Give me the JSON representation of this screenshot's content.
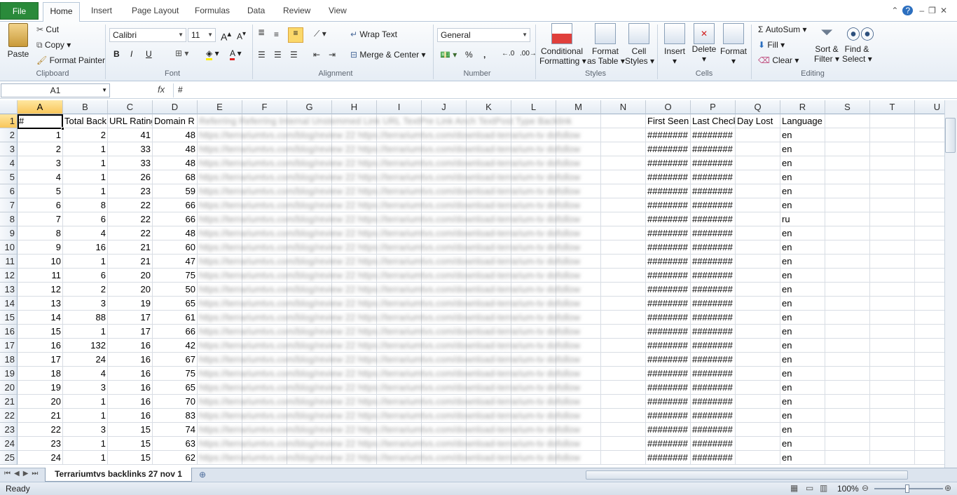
{
  "tabs": {
    "file": "File",
    "home": "Home",
    "insert": "Insert",
    "page_layout": "Page Layout",
    "formulas": "Formulas",
    "data": "Data",
    "review": "Review",
    "view": "View"
  },
  "clipboard": {
    "paste": "Paste",
    "cut": "Cut",
    "copy": "Copy",
    "format_painter": "Format Painter",
    "label": "Clipboard"
  },
  "font": {
    "name": "Calibri",
    "size": "11",
    "bold": "B",
    "italic": "I",
    "underline": "U",
    "label": "Font"
  },
  "alignment": {
    "wrap_text": "Wrap Text",
    "merge_center": "Merge & Center",
    "label": "Alignment"
  },
  "number": {
    "format": "General",
    "percent": "%",
    "comma": ",",
    "label": "Number"
  },
  "styles": {
    "conditional": "Conditional",
    "formatting": "Formatting",
    "format": "Format",
    "as_table": "as Table",
    "cell": "Cell",
    "styles_word": "Styles",
    "label": "Styles"
  },
  "cells": {
    "insert": "Insert",
    "delete": "Delete",
    "format": "Format",
    "label": "Cells"
  },
  "editing": {
    "autosum": "AutoSum",
    "fill": "Fill",
    "clear": "Clear",
    "sort": "Sort &",
    "filter": "Filter",
    "find": "Find &",
    "select": "Select",
    "label": "Editing"
  },
  "formula_bar": {
    "name_box": "A1",
    "fx": "fx",
    "content": "#"
  },
  "columns": [
    "A",
    "B",
    "C",
    "D",
    "E",
    "F",
    "G",
    "H",
    "I",
    "J",
    "K",
    "L",
    "M",
    "N",
    "O",
    "P",
    "Q",
    "R",
    "S",
    "T",
    "U"
  ],
  "headers": {
    "A": "#",
    "B": "Total Back",
    "C": "URL Rating",
    "D": "Domain R",
    "O": "First Seen",
    "P": "Last Check",
    "Q": "Day Lost",
    "R": "Language"
  },
  "blurred_header": "Referring Referring Internal Unstemmed Link URL TextPre Link Anch TextPost Type  Backlink",
  "rows": [
    {
      "n": "2",
      "a": "1",
      "b": "2",
      "c": "41",
      "d": "48",
      "o": "########",
      "p": "########",
      "r": "en"
    },
    {
      "n": "3",
      "a": "2",
      "b": "1",
      "c": "33",
      "d": "48",
      "o": "########",
      "p": "########",
      "r": "en"
    },
    {
      "n": "4",
      "a": "3",
      "b": "1",
      "c": "33",
      "d": "48",
      "o": "########",
      "p": "########",
      "r": "en"
    },
    {
      "n": "5",
      "a": "4",
      "b": "1",
      "c": "26",
      "d": "68",
      "o": "########",
      "p": "########",
      "r": "en"
    },
    {
      "n": "6",
      "a": "5",
      "b": "1",
      "c": "23",
      "d": "59",
      "o": "########",
      "p": "########",
      "r": "en"
    },
    {
      "n": "7",
      "a": "6",
      "b": "8",
      "c": "22",
      "d": "66",
      "o": "########",
      "p": "########",
      "r": "en"
    },
    {
      "n": "8",
      "a": "7",
      "b": "6",
      "c": "22",
      "d": "66",
      "o": "########",
      "p": "########",
      "r": "ru"
    },
    {
      "n": "9",
      "a": "8",
      "b": "4",
      "c": "22",
      "d": "48",
      "o": "########",
      "p": "########",
      "r": "en"
    },
    {
      "n": "10",
      "a": "9",
      "b": "16",
      "c": "21",
      "d": "60",
      "o": "########",
      "p": "########",
      "r": "en"
    },
    {
      "n": "11",
      "a": "10",
      "b": "1",
      "c": "21",
      "d": "47",
      "o": "########",
      "p": "########",
      "r": "en"
    },
    {
      "n": "12",
      "a": "11",
      "b": "6",
      "c": "20",
      "d": "75",
      "o": "########",
      "p": "########",
      "r": "en"
    },
    {
      "n": "13",
      "a": "12",
      "b": "2",
      "c": "20",
      "d": "50",
      "o": "########",
      "p": "########",
      "r": "en"
    },
    {
      "n": "14",
      "a": "13",
      "b": "3",
      "c": "19",
      "d": "65",
      "o": "########",
      "p": "########",
      "r": "en"
    },
    {
      "n": "15",
      "a": "14",
      "b": "88",
      "c": "17",
      "d": "61",
      "o": "########",
      "p": "########",
      "r": "en"
    },
    {
      "n": "16",
      "a": "15",
      "b": "1",
      "c": "17",
      "d": "66",
      "o": "########",
      "p": "########",
      "r": "en"
    },
    {
      "n": "17",
      "a": "16",
      "b": "132",
      "c": "16",
      "d": "42",
      "o": "########",
      "p": "########",
      "r": "en"
    },
    {
      "n": "18",
      "a": "17",
      "b": "24",
      "c": "16",
      "d": "67",
      "o": "########",
      "p": "########",
      "r": "en"
    },
    {
      "n": "19",
      "a": "18",
      "b": "4",
      "c": "16",
      "d": "75",
      "o": "########",
      "p": "########",
      "r": "en"
    },
    {
      "n": "20",
      "a": "19",
      "b": "3",
      "c": "16",
      "d": "65",
      "o": "########",
      "p": "########",
      "r": "en"
    },
    {
      "n": "21",
      "a": "20",
      "b": "1",
      "c": "16",
      "d": "70",
      "o": "########",
      "p": "########",
      "r": "en"
    },
    {
      "n": "22",
      "a": "21",
      "b": "1",
      "c": "16",
      "d": "83",
      "o": "########",
      "p": "########",
      "r": "en"
    },
    {
      "n": "23",
      "a": "22",
      "b": "3",
      "c": "15",
      "d": "74",
      "o": "########",
      "p": "########",
      "r": "en"
    },
    {
      "n": "24",
      "a": "23",
      "b": "1",
      "c": "15",
      "d": "63",
      "o": "########",
      "p": "########",
      "r": "en"
    },
    {
      "n": "25",
      "a": "24",
      "b": "1",
      "c": "15",
      "d": "62",
      "o": "########",
      "p": "########",
      "r": "en"
    }
  ],
  "blurred_row": "https://terrariumtvs.com/blog/review 22 https://terrariumtvs.com/download-terrarium-tv dofollow",
  "sheet_tab": "Terrariumtvs backlinks 27 nov 1",
  "status": {
    "ready": "Ready",
    "zoom": "100%"
  },
  "colors": {
    "file_tab": "#2a8a3a",
    "selection": "#f8c65a"
  }
}
